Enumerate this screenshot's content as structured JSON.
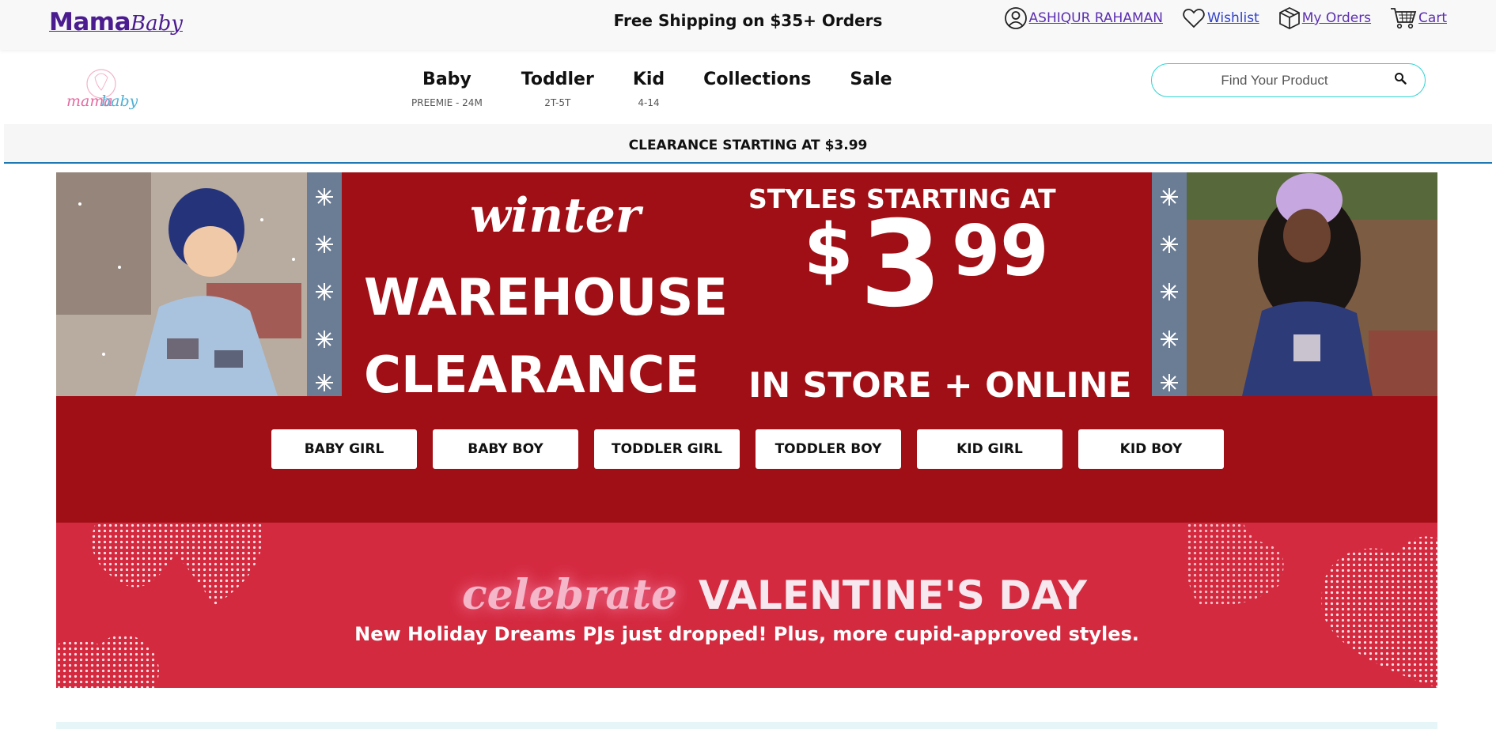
{
  "topbar": {
    "brand_main": "Mama",
    "brand_sub": "Baby",
    "shipping": "Free Shipping on $35+ Orders",
    "links": [
      {
        "label": "ASHIQUR RAHAMAN",
        "icon": "user-icon"
      },
      {
        "label": "Wishlist",
        "icon": "heart-icon"
      },
      {
        "label": "My Orders",
        "icon": "box-icon"
      },
      {
        "label": "Cart",
        "icon": "cart-icon"
      }
    ]
  },
  "logo": {
    "text": "mamababy"
  },
  "nav": {
    "items": [
      {
        "label": "Baby",
        "sub": "PREEMIE - 24M"
      },
      {
        "label": "Toddler",
        "sub": "2T-5T"
      },
      {
        "label": "Kid",
        "sub": "4-14"
      },
      {
        "label": "Collections",
        "sub": ""
      },
      {
        "label": "Sale",
        "sub": ""
      }
    ]
  },
  "search": {
    "placeholder": "Find Your Product",
    "icon": "search-icon"
  },
  "strip": {
    "text": "CLEARANCE STARTING AT $3.99"
  },
  "hero": {
    "winter": "winter",
    "warehouse": "WAREHOUSE",
    "clearance": "CLEARANCE",
    "styles_starting": "STYLES STARTING AT",
    "price_dollar": "$",
    "price_whole": "3",
    "price_cents": "99",
    "in_store": "IN STORE + ONLINE",
    "categories": [
      "BABY GIRL",
      "BABY BOY",
      "TODDLER GIRL",
      "TODDLER BOY",
      "KID GIRL",
      "KID BOY"
    ]
  },
  "valentine": {
    "celebrate": "celebrate",
    "title": "VALENTINE'S DAY",
    "subtitle": "New Holiday Dreams PJs just dropped! Plus, more cupid-approved styles."
  },
  "colors": {
    "brand_purple": "#4b1c8f",
    "link_purple": "#5b2fb0",
    "hero_red": "#a00f16",
    "valentine_red": "#d42a40",
    "search_border": "#2fd3d3",
    "strip_border": "#1e78b4"
  }
}
